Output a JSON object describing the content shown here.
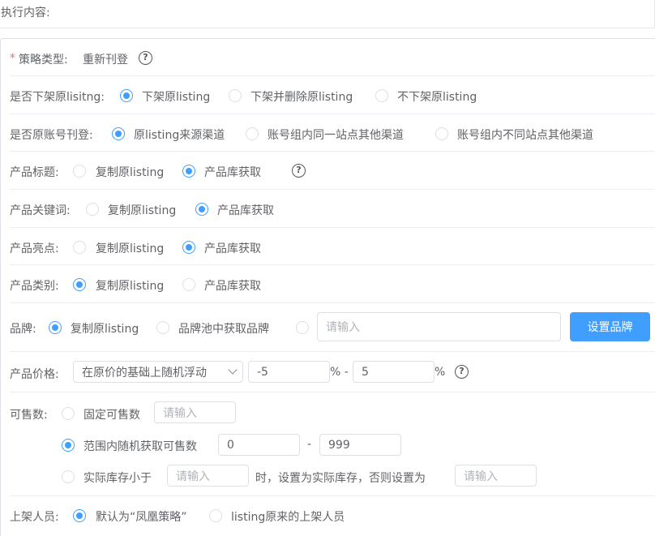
{
  "header": {
    "exec_label": "执行内容:"
  },
  "strategy": {
    "required_mark": "*",
    "label": "策略类型:",
    "value": "重新刊登",
    "help_icon": "question-circle-icon"
  },
  "delist": {
    "label": "是否下架原lisitng:",
    "options": [
      {
        "label": "下架原listing",
        "selected": true
      },
      {
        "label": "下架并删除原listing",
        "selected": false
      },
      {
        "label": "不下架原listing",
        "selected": false
      }
    ]
  },
  "account": {
    "label": "是否原账号刊登:",
    "options": [
      {
        "label": "原listing来源渠道",
        "selected": true
      },
      {
        "label": "账号组内同一站点其他渠道",
        "selected": false
      },
      {
        "label": "账号组内不同站点其他渠道",
        "selected": false
      }
    ]
  },
  "title": {
    "label": "产品标题:",
    "options": [
      {
        "label": "复制原listing",
        "selected": false
      },
      {
        "label": "产品库获取",
        "selected": true
      }
    ],
    "help_icon": "question-circle-icon"
  },
  "keywords": {
    "label": "产品关键词:",
    "options": [
      {
        "label": "复制原listing",
        "selected": false
      },
      {
        "label": "产品库获取",
        "selected": true
      }
    ]
  },
  "highlights": {
    "label": "产品亮点:",
    "options": [
      {
        "label": "复制原listing",
        "selected": false
      },
      {
        "label": "产品库获取",
        "selected": true
      }
    ]
  },
  "category": {
    "label": "产品类别:",
    "options": [
      {
        "label": "复制原listing",
        "selected": true
      },
      {
        "label": "产品库获取",
        "selected": false
      }
    ]
  },
  "brand": {
    "label": "品牌:",
    "options": [
      {
        "label": "复制原listing",
        "selected": true
      },
      {
        "label": "品牌池中获取品牌",
        "selected": false
      }
    ],
    "input_placeholder": "请输入",
    "button_label": "设置品牌"
  },
  "price": {
    "label": "产品价格:",
    "select_value": "在原价的基础上随机浮动",
    "min_value": "-5",
    "percent_dash": "% -",
    "max_value": "5",
    "percent": "%",
    "help_icon": "question-circle-icon"
  },
  "stock": {
    "label": "可售数:",
    "fixed_label": "固定可售数",
    "fixed_placeholder": "请输入",
    "range_label": "范围内随机获取可售数",
    "range_min": "0",
    "range_dash": "-",
    "range_max": "999",
    "actual_label": "实际库存小于",
    "actual_placeholder": "请输入",
    "actual_mid": "时，设置为实际库存，否则设置为",
    "actual_else_placeholder": "请输入",
    "selected": "range"
  },
  "lister": {
    "label": "上架人员:",
    "options": [
      {
        "label": "默认为“凤凰策略”",
        "selected": true
      },
      {
        "label": "listing原来的上架人员",
        "selected": false
      }
    ]
  },
  "colors": {
    "primary": "#409eff",
    "border": "#dcdfe6",
    "text": "#606266",
    "required": "#f56c6c"
  }
}
